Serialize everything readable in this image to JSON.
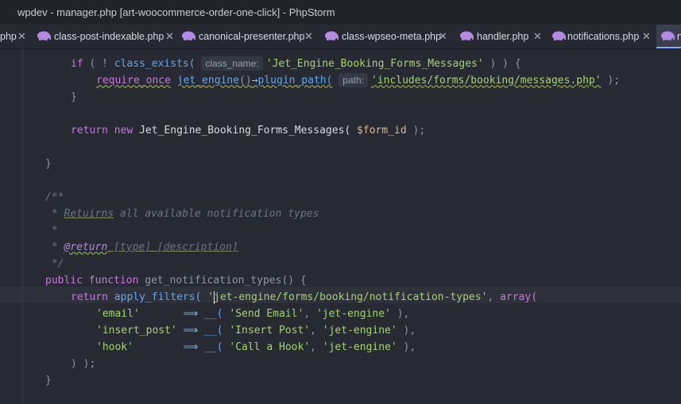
{
  "window": {
    "title": "wpdev - manager.php [art-woocommerce-order-one-click] - PhpStorm"
  },
  "tabs": [
    {
      "label": "php",
      "active": false
    },
    {
      "label": "class-post-indexable.php",
      "active": false
    },
    {
      "label": "canonical-presenter.php",
      "active": false
    },
    {
      "label": "class-wpseo-meta.php",
      "active": false
    },
    {
      "label": "handler.php",
      "active": false
    },
    {
      "label": "notifications.php",
      "active": false
    },
    {
      "label": "n",
      "active": true
    }
  ],
  "code": {
    "l1_if": "if",
    "l1_p1": " ( ! ",
    "l1_fn": "class_exists(",
    "l1_hint": "class_name:",
    "l1_str": "'Jet_Engine_Booking_Forms_Messages'",
    "l1_end": " ) ) {",
    "l2_req": "require_once",
    "l2_fn": "jet_engine",
    "l2_paren": "()",
    "l2_arrow": "→",
    "l2_call": "plugin_path(",
    "l2_hint": "path:",
    "l2_str": "'includes/forms/booking/messages.php'",
    "l2_end": " );",
    "l3": "}",
    "l4_return": "return",
    "l4_new": "new",
    "l4_class": "Jet_Engine_Booking_Forms_Messages(",
    "l4_var": "$form_id",
    "l4_end": " );",
    "l5": "}",
    "doc1": "/**",
    "doc2_star": " * ",
    "doc2_word": "Retuirns",
    "doc2_rest": " all available notification types",
    "doc3": " *",
    "doc4_star": " * ",
    "doc4_tag": "@return",
    "doc4_rest": " [type] [description]",
    "doc5": " */",
    "sig_public": "public",
    "sig_function": "function",
    "sig_name": "get_notification_types",
    "sig_end": "() {",
    "r_return": "return",
    "r_fn": "apply_filters(",
    "r_q": " '",
    "r_str": "jet-engine/forms/booking/notification-types'",
    "r_comma": ", ",
    "r_array": "array(",
    "a1_key": "'email'",
    "a1_arrow": "⟹",
    "a1_fn": "__(",
    "a1_s1": "'Send Email'",
    "a1_s2": "'jet-engine'",
    "a1_end": " ),",
    "a2_key": "'insert_post'",
    "a2_arrow": "⟹",
    "a2_fn": "__(",
    "a2_s1": "'Insert Post'",
    "a2_s2": "'jet-engine'",
    "a2_end": " ),",
    "a3_key": "'hook'",
    "a3_arrow": "⟹",
    "a3_fn": "__(",
    "a3_s1": "'Call a Hook'",
    "a3_s2": "'jet-engine'",
    "a3_end": " ),",
    "close1": ") );",
    "close2": "}"
  }
}
